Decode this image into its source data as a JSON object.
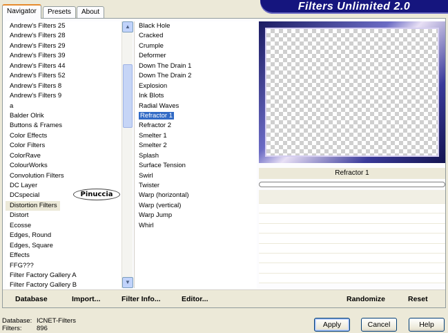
{
  "tabs": [
    "Navigator",
    "Presets",
    "About"
  ],
  "banner_title": "Filters Unlimited 2.0",
  "categories": [
    "Andrew's Filters 25",
    "Andrew's Filters 28",
    "Andrew's Filters 29",
    "Andrew's Filters 39",
    "Andrew's Filters 44",
    "Andrew's Filters 52",
    "Andrew's Filters 8",
    "Andrew's Filters 9",
    "a",
    "Balder Olrik",
    "Buttons & Frames",
    "Color Effects",
    "Color Filters",
    "ColorRave",
    "ColourWorks",
    "Convolution Filters",
    "DC Layer",
    "DCspecial",
    "Distortion Filters",
    "Distort",
    "Ecosse",
    "Edges, Round",
    "Edges, Square",
    "Effects",
    "FFG???",
    "Filter Factory Gallery A",
    "Filter Factory Gallery B"
  ],
  "selected_category": "Distortion Filters",
  "filters": [
    "Black Hole",
    "Cracked",
    "Crumple",
    "Deformer",
    "Down The Drain 1",
    "Down The Drain 2",
    "Explosion",
    "Ink Blots",
    "Radial Waves",
    "Refractor 1",
    "Refractor 2",
    "Smelter 1",
    "Smelter 2",
    "Splash",
    "Surface Tension",
    "Swirl",
    "Twister",
    "Warp (horizontal)",
    "Warp (vertical)",
    "Warp Jump",
    "Whirl"
  ],
  "selected_filter": "Refractor 1",
  "watermark": "Pinuccia",
  "preview": {
    "filter_name": "Refractor 1"
  },
  "bottom_buttons": {
    "database": "Database",
    "import": "Import...",
    "filter_info": "Filter Info...",
    "editor": "Editor...",
    "randomize": "Randomize",
    "reset": "Reset"
  },
  "status": {
    "database_label": "Database:",
    "database_value": "ICNET-Filters",
    "filters_label": "Filters:",
    "filters_value": "896"
  },
  "dialog_buttons": {
    "apply": "Apply",
    "cancel": "Cancel",
    "help": "Help"
  },
  "icons": {
    "scroll_up": "arrow-up-icon",
    "scroll_down": "arrow-down-icon"
  },
  "colors": {
    "accent": "#316ac5",
    "banner": "#15157e"
  }
}
